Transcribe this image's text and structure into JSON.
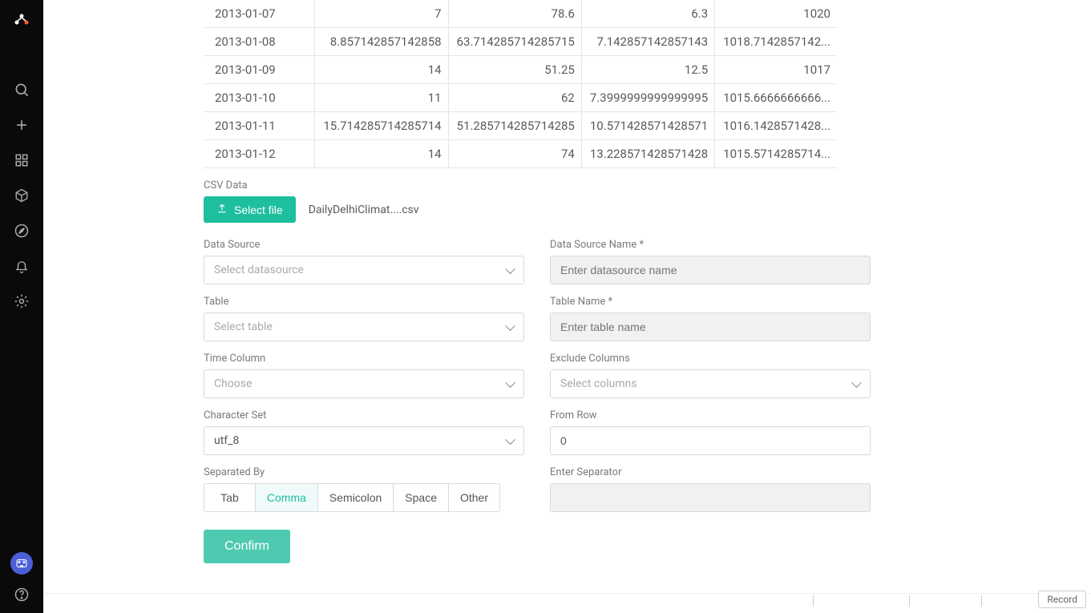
{
  "table": {
    "rows": [
      {
        "date": "2013-01-07",
        "c2": "7",
        "c3": "78.6",
        "c4": "6.3",
        "c5": "1020"
      },
      {
        "date": "2013-01-08",
        "c2": "8.857142857142858",
        "c3": "63.714285714285715",
        "c4": "7.142857142857143",
        "c5": "1018.7142857142..."
      },
      {
        "date": "2013-01-09",
        "c2": "14",
        "c3": "51.25",
        "c4": "12.5",
        "c5": "1017"
      },
      {
        "date": "2013-01-10",
        "c2": "11",
        "c3": "62",
        "c4": "7.3999999999999995",
        "c5": "1015.6666666666..."
      },
      {
        "date": "2013-01-11",
        "c2": "15.714285714285714",
        "c3": "51.285714285714285",
        "c4": "10.571428571428571",
        "c5": "1016.1428571428..."
      },
      {
        "date": "2013-01-12",
        "c2": "14",
        "c3": "74",
        "c4": "13.228571428571428",
        "c5": "1015.5714285714..."
      }
    ]
  },
  "labels": {
    "csvdata": "CSV Data",
    "select_file": "Select file",
    "filename": "DailyDelhiClimat....csv",
    "data_source": "Data Source",
    "data_source_ph": "Select datasource",
    "data_source_name": "Data Source Name *",
    "data_source_name_ph": "Enter datasource name",
    "table": "Table",
    "table_ph": "Select table",
    "table_name": "Table Name *",
    "table_name_ph": "Enter table name",
    "time_column": "Time Column",
    "time_column_ph": "Choose",
    "exclude_columns": "Exclude Columns",
    "exclude_columns_ph": "Select columns",
    "charset": "Character Set",
    "charset_val": "utf_8",
    "from_row": "From Row",
    "from_row_val": "0",
    "separated_by": "Separated By",
    "enter_separator": "Enter Separator",
    "confirm": "Confirm",
    "record": "Record"
  },
  "separators": {
    "tab": "Tab",
    "comma": "Comma",
    "semicolon": "Semicolon",
    "space": "Space",
    "other": "Other"
  }
}
